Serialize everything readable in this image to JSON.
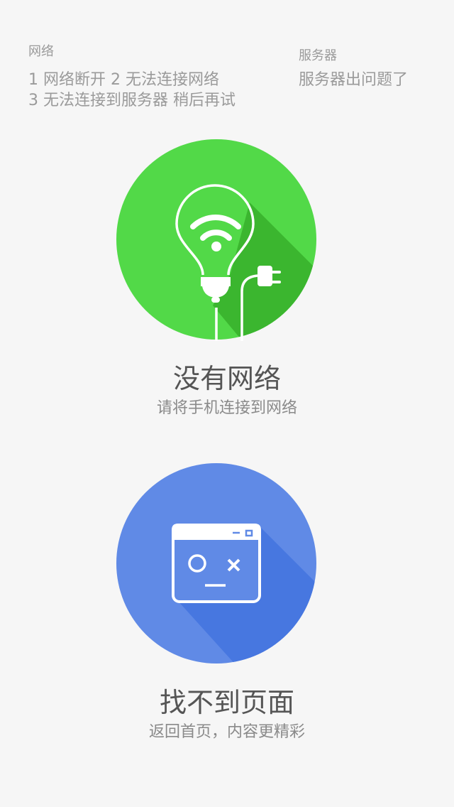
{
  "notes": {
    "network_heading": "网络",
    "network_line1": "1  网络断开    2  无法连接网络",
    "network_line2": "3  无法连接到服务器  稍后再试",
    "server_heading": "服务器",
    "server_line1": "服务器出问题了"
  },
  "no_network": {
    "icon": "lightbulb-wifi-plug-icon",
    "color": "#52d948",
    "shadow_color": "#3bb62f",
    "title": "没有网络",
    "subtitle": "请将手机连接到网络"
  },
  "not_found": {
    "icon": "broken-window-face-icon",
    "color": "#608ae6",
    "shadow_color": "#4777e0",
    "title": "找不到页面",
    "subtitle": "返回首页，内容更精彩"
  }
}
